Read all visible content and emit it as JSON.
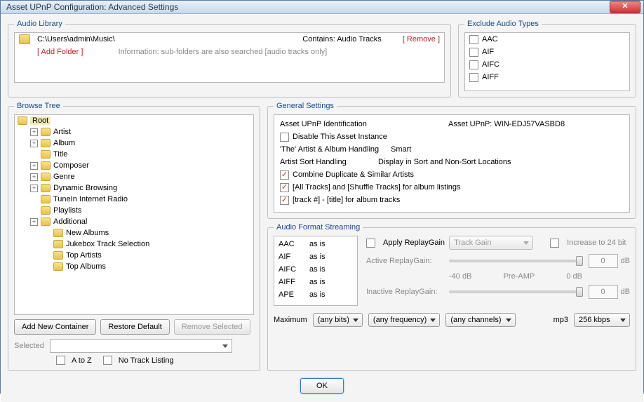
{
  "window": {
    "title": "Asset UPnP Configuration: Advanced Settings"
  },
  "audio_library": {
    "legend": "Audio Library",
    "path": "C:\\Users\\admin\\Music\\",
    "contains": "Contains: Audio Tracks",
    "remove": "[ Remove ]",
    "add_folder": "[ Add Folder ]",
    "info": "Information: sub-folders are also searched [audio tracks only]"
  },
  "exclude": {
    "legend": "Exclude Audio Types",
    "items": [
      "AAC",
      "AIF",
      "AIFC",
      "AIFF"
    ]
  },
  "browse": {
    "legend": "Browse Tree",
    "root": "Root",
    "items": [
      {
        "label": "Artist",
        "exp": "+"
      },
      {
        "label": "Album",
        "exp": "+"
      },
      {
        "label": "Title",
        "exp": ""
      },
      {
        "label": "Composer",
        "exp": "+"
      },
      {
        "label": "Genre",
        "exp": "+"
      },
      {
        "label": "Dynamic Browsing",
        "exp": "+"
      },
      {
        "label": "TuneIn Internet Radio",
        "exp": ""
      },
      {
        "label": "Playlists",
        "exp": ""
      },
      {
        "label": "Additional",
        "exp": "+"
      },
      {
        "label": "New Albums",
        "exp": "",
        "ind": 2
      },
      {
        "label": "Jukebox Track Selection",
        "exp": "",
        "ind": 2
      },
      {
        "label": "Top Artists",
        "exp": "",
        "ind": 2
      },
      {
        "label": "Top Albums",
        "exp": "",
        "ind": 2
      }
    ],
    "add_container": "Add New Container",
    "restore": "Restore Default",
    "remove_selected": "Remove Selected",
    "selected": "Selected",
    "a_to_z": "A to Z",
    "no_track": "No Track Listing"
  },
  "general": {
    "legend": "General Settings",
    "ident_label": "Asset UPnP Identification",
    "ident_value": "Asset UPnP: WIN-EDJ57VASBD8",
    "disable": "Disable This Asset Instance",
    "the_handling_label": "'The' Artist & Album Handling",
    "the_handling_value": "Smart",
    "sort_label": "Artist Sort Handling",
    "sort_value": "Display in Sort and Non-Sort Locations",
    "combine": "Combine Duplicate & Similar Artists",
    "all_tracks": "[All Tracks] and [Shuffle Tracks] for album listings",
    "track_fmt": "[track #] - [title] for album tracks"
  },
  "streaming": {
    "legend": "Audio Format Streaming",
    "formats": [
      {
        "name": "AAC",
        "mode": "as is"
      },
      {
        "name": "AIF",
        "mode": "as is"
      },
      {
        "name": "AIFC",
        "mode": "as is"
      },
      {
        "name": "AIFF",
        "mode": "as is"
      },
      {
        "name": "APE",
        "mode": "as is"
      }
    ],
    "apply_replaygain": "Apply ReplayGain",
    "track_gain": "Track Gain",
    "increase_24": "Increase to 24 bit",
    "active_label": "Active ReplayGain:",
    "inactive_label": "Inactive ReplayGain:",
    "active_val": "0",
    "inactive_val": "0",
    "db": "dB",
    "minus40": "-40 dB",
    "preamp": "Pre-AMP",
    "zero_db": "0 dB",
    "maximum": "Maximum",
    "any_bits": "(any bits)",
    "any_freq": "(any frequency)",
    "any_ch": "(any channels)",
    "mp3": "mp3",
    "kbps": "256 kbps"
  },
  "ok": "OK"
}
